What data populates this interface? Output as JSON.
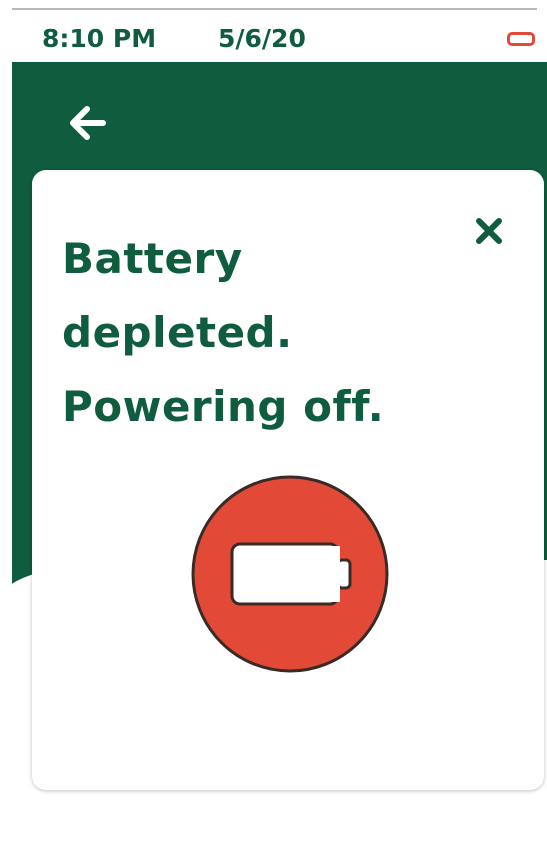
{
  "status_bar": {
    "time": "8:10 PM",
    "date": "5/6/20",
    "battery_icon": "battery-low-icon"
  },
  "header": {
    "back_icon": "arrow-left-icon"
  },
  "dialog": {
    "message_line1": "Battery",
    "message_line2": "depleted.",
    "message_line3": "Powering off.",
    "close_icon": "close-icon",
    "alert_icon": "battery-empty-icon"
  },
  "colors": {
    "brand_green": "#0f5d3e",
    "alert_red": "#e24a37",
    "background": "#ffffff"
  }
}
